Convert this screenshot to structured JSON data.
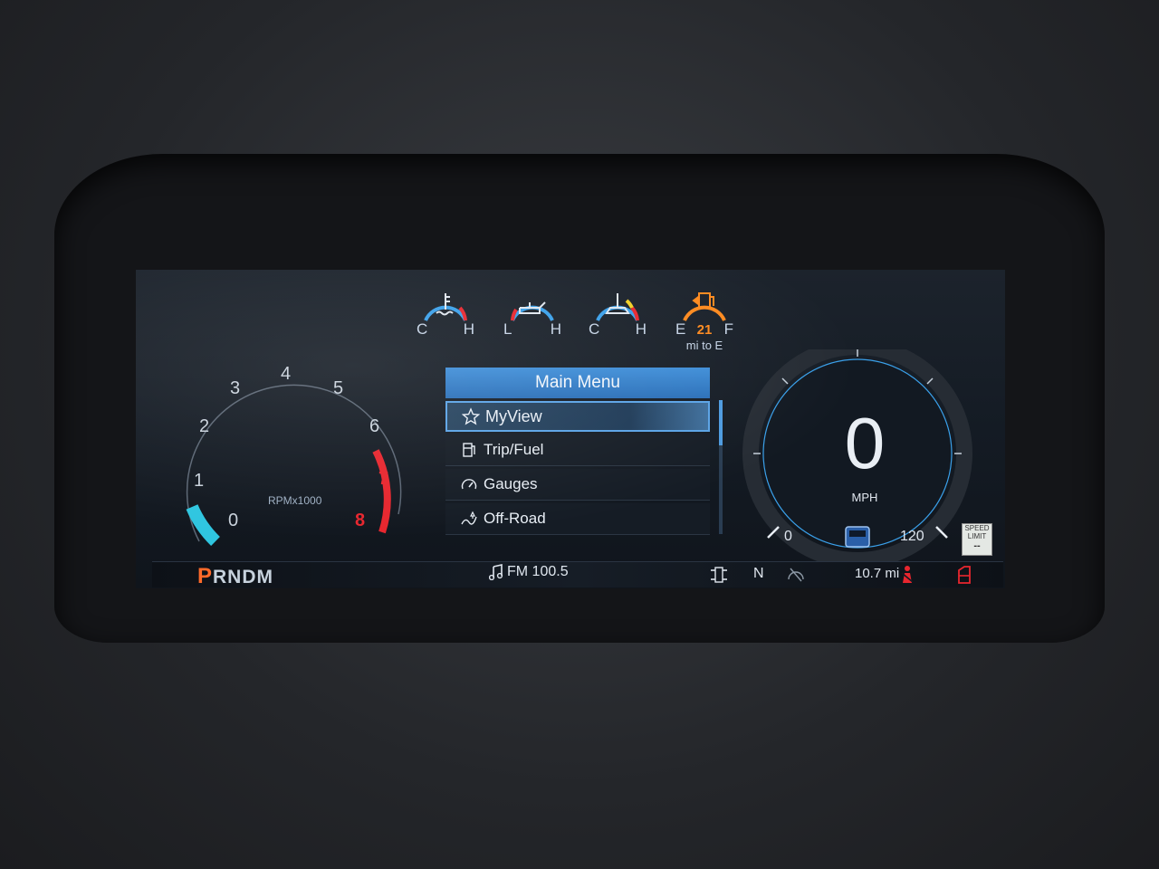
{
  "colors": {
    "accent": "#3f8ed8",
    "gauge_blue": "#3aa0ea",
    "warning_orange": "#ff8a1e",
    "redline": "#e8262e",
    "gear_active": "#ff6a2a",
    "tach_needle": "#2fc6e0"
  },
  "top_gauges": [
    {
      "icon": "coolant-temp-icon",
      "low": "C",
      "high": "H"
    },
    {
      "icon": "oil-pressure-icon",
      "low": "L",
      "high": "H"
    },
    {
      "icon": "transmission-temp-icon",
      "low": "C",
      "high": "H"
    },
    {
      "icon": "fuel-pump-icon",
      "low": "E",
      "high": "F",
      "value": "21",
      "sub": "mi to E"
    }
  ],
  "tachometer": {
    "ticks": [
      "0",
      "1",
      "2",
      "3",
      "4",
      "5",
      "6",
      "7",
      "8"
    ],
    "redline_ticks": [
      "7",
      "8"
    ],
    "label": "RPMx1000"
  },
  "menu": {
    "title": "Main Menu",
    "items": [
      {
        "label": "MyView",
        "icon": "star-icon",
        "selected": true
      },
      {
        "label": "Trip/Fuel",
        "icon": "fuel-pump-icon",
        "selected": false
      },
      {
        "label": "Gauges",
        "icon": "gauge-icon",
        "selected": false
      },
      {
        "label": "Off-Road",
        "icon": "off-road-icon",
        "selected": false
      }
    ]
  },
  "speedometer": {
    "value": "0",
    "unit": "MPH",
    "min": "0",
    "max": "120"
  },
  "speed_limit": {
    "line1": "SPEED",
    "line2": "LIMIT",
    "value": "--"
  },
  "bottom_bar": {
    "gear_active": "P",
    "gear_rest": "RNDM",
    "radio": "FM 100.5",
    "transfer": "N",
    "odometer": "10.7 mi"
  }
}
